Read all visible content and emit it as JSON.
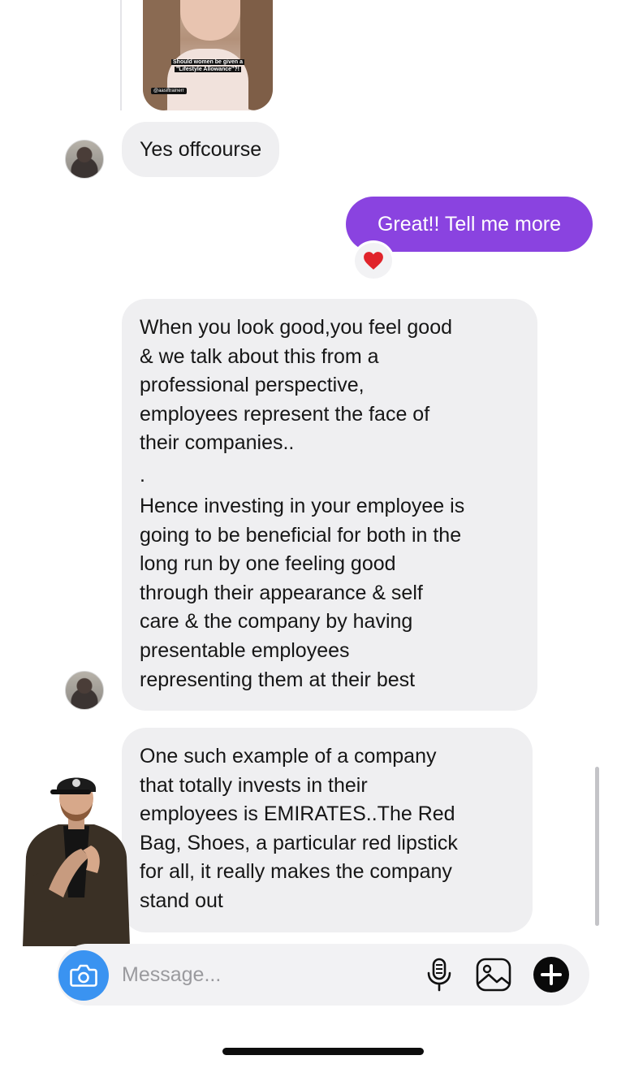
{
  "thread": {
    "shared_post": {
      "caption_lines": [
        "Should women be given a",
        "\"Lifestyle Allowance\"?!"
      ],
      "handle": "@aasiftrainerr"
    },
    "messages": [
      {
        "direction": "incoming",
        "lines": [
          "Yes offcourse"
        ]
      },
      {
        "direction": "outgoing",
        "lines": [
          "Great!! Tell me more"
        ],
        "reaction": "heart"
      },
      {
        "direction": "incoming",
        "lines": [
          "When you look good,you feel good",
          "& we talk about this from a",
          "professional perspective,",
          "employees represent the face of",
          "their companies..",
          ".",
          "Hence investing in your employee is",
          "going to be beneficial for both in the",
          "long run by one feeling good",
          "through their appearance & self",
          "care & the company by having",
          "presentable employees",
          "representing them at their best"
        ]
      },
      {
        "direction": "incoming",
        "lines": [
          "One such example of a company",
          "that totally invests in their",
          "employees is EMIRATES..The Red",
          "Bag, Shoes, a particular red lipstick",
          "for all, it really makes the company",
          "stand out"
        ]
      }
    ]
  },
  "composer": {
    "placeholder": "Message...",
    "icons": [
      "camera-icon",
      "microphone-icon",
      "gallery-icon",
      "plus-circle-icon"
    ]
  },
  "colors": {
    "outgoing_bubble": "#8a43e0",
    "incoming_bubble": "#efeff1",
    "camera_button": "#3a93f1",
    "reaction_heart": "#e0242b"
  }
}
